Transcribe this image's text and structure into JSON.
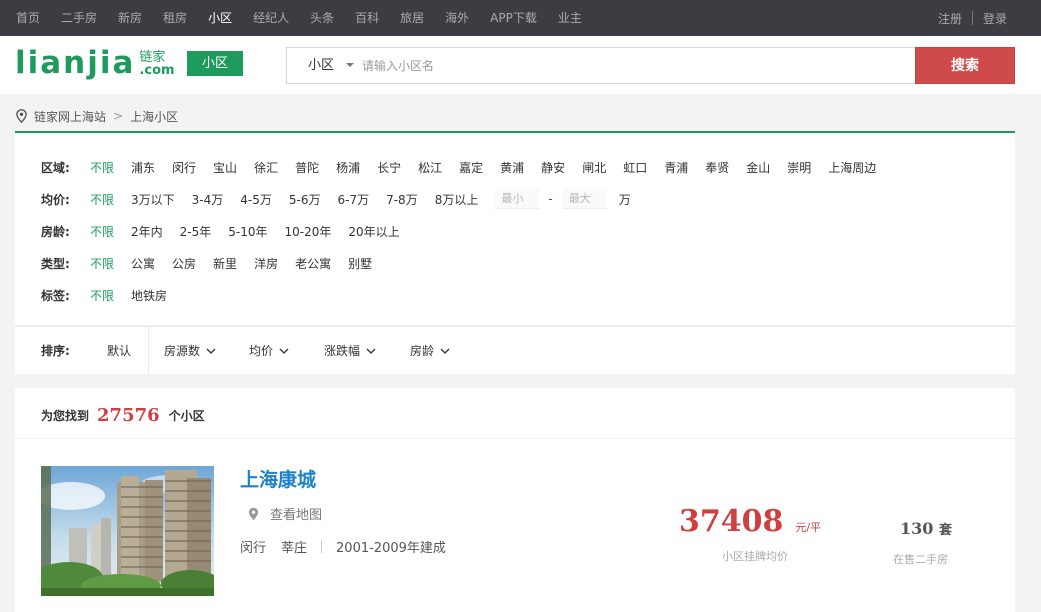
{
  "topnav": {
    "items": [
      "首页",
      "二手房",
      "新房",
      "租房",
      "小区",
      "经纪人",
      "头条",
      "百科",
      "旅居",
      "海外",
      "APP下载",
      "业主"
    ],
    "active_index": 4,
    "register": "注册",
    "login": "登录"
  },
  "header": {
    "logo_word": "lianjia",
    "logo_cn": "链家",
    "logo_domain": ".com",
    "section_badge": "小区",
    "search_category": "小区",
    "search_placeholder": "请输入小区名",
    "search_button": "搜索"
  },
  "breadcrumb": {
    "items": [
      "链家网上海站",
      "上海小区"
    ],
    "separator": ">"
  },
  "filters": {
    "district": {
      "label": "区域:",
      "options": [
        "不限",
        "浦东",
        "闵行",
        "宝山",
        "徐汇",
        "普陀",
        "杨浦",
        "长宁",
        "松江",
        "嘉定",
        "黄浦",
        "静安",
        "闸北",
        "虹口",
        "青浦",
        "奉贤",
        "金山",
        "崇明",
        "上海周边"
      ]
    },
    "price": {
      "label": "均价:",
      "options": [
        "不限",
        "3万以下",
        "3-4万",
        "4-5万",
        "5-6万",
        "6-7万",
        "7-8万",
        "8万以上"
      ],
      "min_placeholder": "最小",
      "max_placeholder": "最大",
      "range_dash": "-",
      "unit": "万"
    },
    "age": {
      "label": "房龄:",
      "options": [
        "不限",
        "2年内",
        "2-5年",
        "5-10年",
        "10-20年",
        "20年以上"
      ]
    },
    "type": {
      "label": "类型:",
      "options": [
        "不限",
        "公寓",
        "公房",
        "新里",
        "洋房",
        "老公寓",
        "别墅"
      ]
    },
    "tag": {
      "label": "标签:",
      "options": [
        "不限",
        "地铁房"
      ]
    }
  },
  "sort": {
    "label": "排序:",
    "default": "默认",
    "items": [
      "房源数",
      "均价",
      "涨跌幅",
      "房龄"
    ]
  },
  "results": {
    "prefix": "为您找到",
    "count": "27576",
    "suffix": "个小区"
  },
  "listing": {
    "title": "上海康城",
    "map_link": "查看地图",
    "district": "闵行",
    "area": "莘庄",
    "built": "2001-2009年建成",
    "price": "37408",
    "price_unit": "元/平",
    "price_label": "小区挂牌均价",
    "count": "130",
    "count_unit": "套",
    "count_label": "在售二手房"
  },
  "colors": {
    "brand_green": "#1c9b5c",
    "accent_red": "#cf4a4a",
    "price_red": "#cf3f3f",
    "link_blue": "#1d82c8",
    "topbar_bg": "#3b3d43"
  }
}
